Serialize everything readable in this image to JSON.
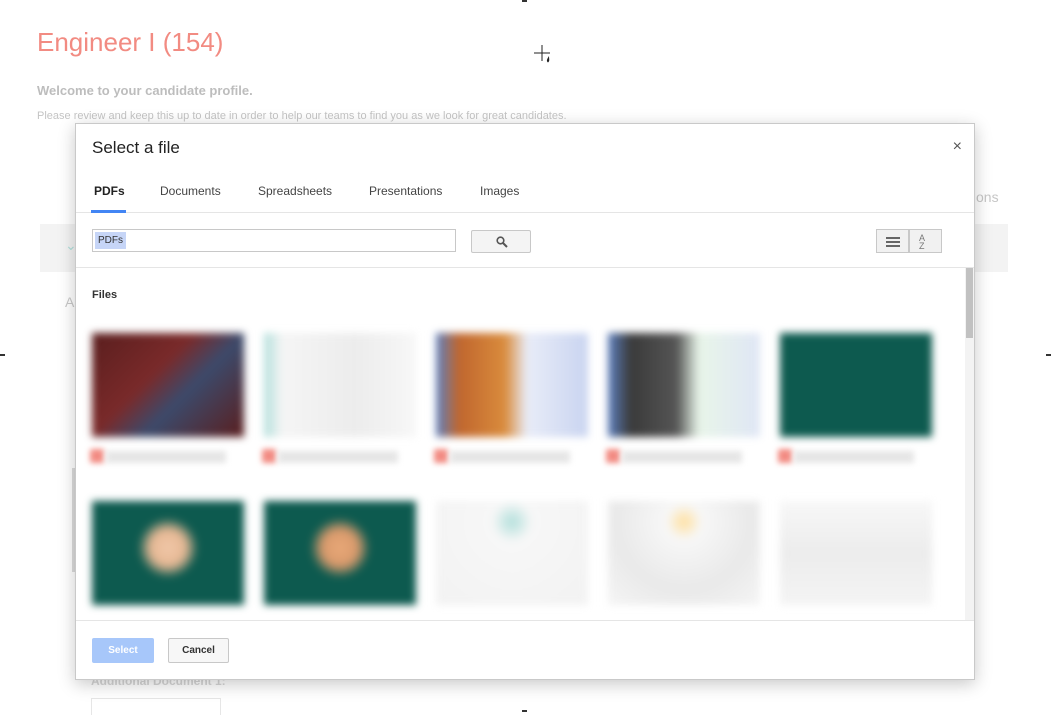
{
  "page": {
    "title": "Engineer I (154)",
    "welcome": "Welcome to your candidate profile.",
    "intro": "Please review and keep this up to date in order to help our teams to find you as we look for great candidates.",
    "right_partial": "ons",
    "section_partial_letter": "A",
    "bottom_label": "Additional Document 1:"
  },
  "dialog": {
    "title": "Select a file",
    "close_glyph": "×",
    "tabs": [
      {
        "label": "PDFs",
        "active": true
      },
      {
        "label": "Documents",
        "active": false
      },
      {
        "label": "Spreadsheets",
        "active": false
      },
      {
        "label": "Presentations",
        "active": false
      },
      {
        "label": "Images",
        "active": false
      }
    ],
    "search": {
      "value": "PDFs"
    },
    "files_heading": "Files",
    "select_label": "Select",
    "cancel_label": "Cancel",
    "sort_label_top": "A",
    "sort_label_bottom": "Z",
    "accent_color": "#4285f4"
  },
  "icons": {
    "search": "search-icon",
    "list_view": "list-view-icon",
    "sort": "sort-az-icon",
    "close": "close-icon",
    "cursor": "move-cursor-icon"
  }
}
